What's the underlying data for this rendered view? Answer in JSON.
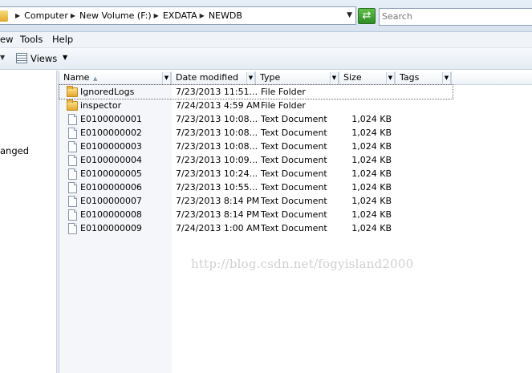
{
  "address_bar": {
    "crumbs": [
      "Computer",
      "New Volume (F:)",
      "EXDATA",
      "NEWDB"
    ],
    "search_placeholder": "Search"
  },
  "menu": {
    "items": [
      "ew",
      "Tools",
      "Help"
    ]
  },
  "toolbar": {
    "views_label": "Views"
  },
  "nav_pane": {
    "visible_item": "anged"
  },
  "columns": {
    "name": "Name",
    "date": "Date modified",
    "type": "Type",
    "size": "Size",
    "tags": "Tags"
  },
  "files": [
    {
      "name": "IgnoredLogs",
      "date": "7/23/2013 11:51...",
      "type": "File Folder",
      "size": "",
      "icon": "folder-icon"
    },
    {
      "name": "inspector",
      "date": "7/24/2013 4:59 AM",
      "type": "File Folder",
      "size": "",
      "icon": "folder-icon"
    },
    {
      "name": "E0100000001",
      "date": "7/23/2013 10:08...",
      "type": "Text Document",
      "size": "1,024 KB",
      "icon": "text-document-icon"
    },
    {
      "name": "E0100000002",
      "date": "7/23/2013 10:08...",
      "type": "Text Document",
      "size": "1,024 KB",
      "icon": "text-document-icon"
    },
    {
      "name": "E0100000003",
      "date": "7/23/2013 10:08...",
      "type": "Text Document",
      "size": "1,024 KB",
      "icon": "text-document-icon"
    },
    {
      "name": "E0100000004",
      "date": "7/23/2013 10:09...",
      "type": "Text Document",
      "size": "1,024 KB",
      "icon": "text-document-icon"
    },
    {
      "name": "E0100000005",
      "date": "7/23/2013 10:24...",
      "type": "Text Document",
      "size": "1,024 KB",
      "icon": "text-document-icon"
    },
    {
      "name": "E0100000006",
      "date": "7/23/2013 10:55...",
      "type": "Text Document",
      "size": "1,024 KB",
      "icon": "text-document-icon"
    },
    {
      "name": "E0100000007",
      "date": "7/23/2013 8:14 PM",
      "type": "Text Document",
      "size": "1,024 KB",
      "icon": "text-document-icon"
    },
    {
      "name": "E0100000008",
      "date": "7/23/2013 8:14 PM",
      "type": "Text Document",
      "size": "1,024 KB",
      "icon": "text-document-icon"
    },
    {
      "name": "E0100000009",
      "date": "7/24/2013 1:00 AM",
      "type": "Text Document",
      "size": "1,024 KB",
      "icon": "text-document-icon"
    }
  ],
  "watermark": "http://blog.csdn.net/fogyisland2000",
  "colors": {
    "accent": "#2f8c22",
    "chrome": "#dde6f1"
  }
}
